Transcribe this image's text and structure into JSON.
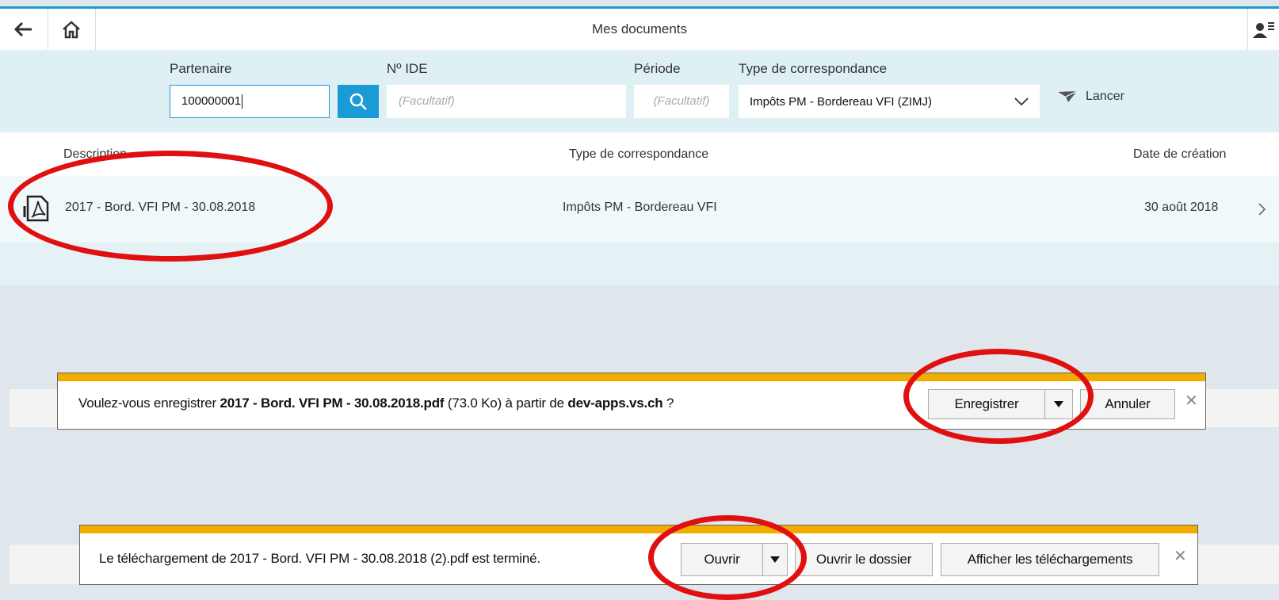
{
  "app": {
    "title": "Mes documents"
  },
  "filters": {
    "partner_label": "Partenaire",
    "partner_value": "100000001",
    "ide_label": "Nº IDE",
    "ide_placeholder": "(Facultatif)",
    "period_label": "Période",
    "period_placeholder": "(Facultatif)",
    "type_label": "Type de correspondance",
    "type_value": "Impôts PM - Bordereau VFI (ZIMJ)",
    "launch_label": "Lancer"
  },
  "table": {
    "columns": [
      "Description",
      "Type de correspondance",
      "Date de création"
    ],
    "rows": [
      {
        "description": "2017 - Bord. VFI PM - 30.08.2018",
        "type": "Impôts PM - Bordereau VFI",
        "date": "30 août 2018"
      }
    ]
  },
  "save_prompt": {
    "prefix": "Voulez-vous enregistrer ",
    "filename": "2017 - Bord. VFI PM - 30.08.2018.pdf",
    "size": " (73.0 Ko) à partir de ",
    "host": "dev-apps.vs.ch",
    "suffix": " ?",
    "save_label": "Enregistrer",
    "cancel_label": "Annuler"
  },
  "download_done": {
    "message": "Le téléchargement de 2017 - Bord. VFI PM - 30.08.2018 (2).pdf est terminé.",
    "open_label": "Ouvrir",
    "open_folder_label": "Ouvrir le dossier",
    "show_downloads_label": "Afficher les téléchargements"
  },
  "colors": {
    "accent": "#1a9ad6",
    "notification": "#f0ad00",
    "annotation": "#e01010"
  },
  "icons": {
    "back": "arrow-left-icon",
    "home": "home-icon",
    "user": "user-menu-icon",
    "search": "search-icon",
    "launch": "paper-plane-icon",
    "document": "pdf-document-icon",
    "row_nav": "chevron-right-icon",
    "select": "chevron-down-icon",
    "split": "triangle-down-icon",
    "close": "close-icon"
  }
}
